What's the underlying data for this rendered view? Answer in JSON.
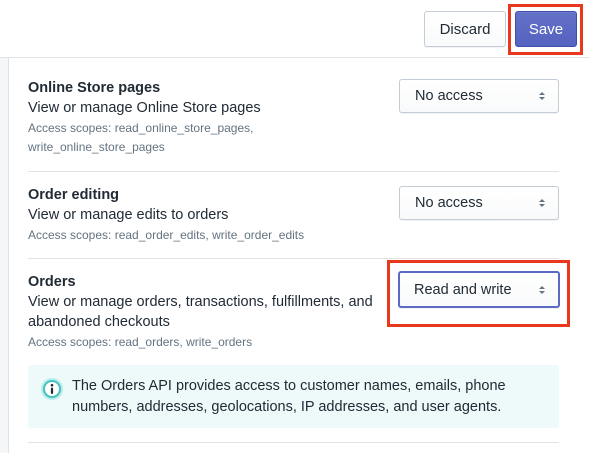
{
  "toolbar": {
    "discard_label": "Discard",
    "save_label": "Save"
  },
  "permissions": [
    {
      "title": "Online Store pages",
      "description": "View or manage Online Store pages",
      "scopes_line1": "Access scopes: read_online_store_pages,",
      "scopes_line2": "write_online_store_pages",
      "access": "No access"
    },
    {
      "title": "Order editing",
      "description": "View or manage edits to orders",
      "scopes_line1": "Access scopes: read_order_edits, write_order_edits",
      "access": "No access"
    },
    {
      "title": "Orders",
      "description_line1": "View or manage orders, transactions, fulfillments, and",
      "description_line2": "abandoned checkouts",
      "scopes_line1": "Access scopes: read_orders, write_orders",
      "access": "Read and write"
    }
  ],
  "banner": {
    "icon": "info-icon",
    "text_line1": "The Orders API provides access to customer names, emails, phone",
    "text_line2": "numbers, addresses, geolocations, IP addresses, and user agents."
  },
  "colors": {
    "accent": "#5c6ac4",
    "highlight": "#e8391d",
    "info_bg": "#eef9f9",
    "info_icon": "#47c1bf"
  }
}
